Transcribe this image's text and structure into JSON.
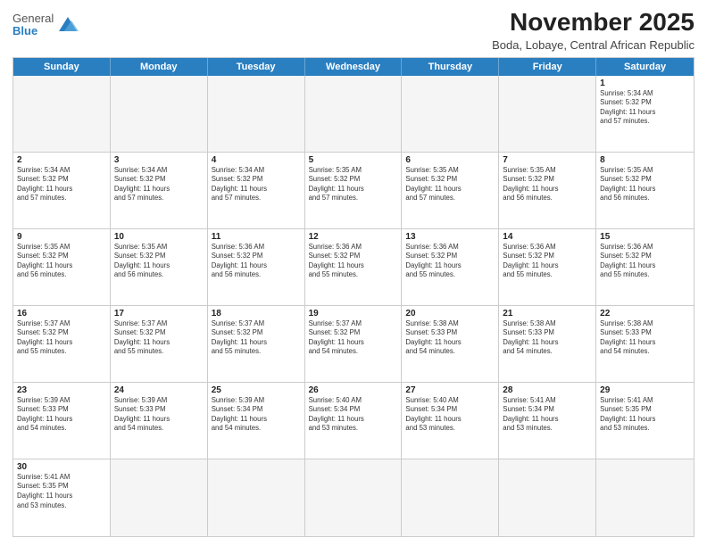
{
  "header": {
    "logo_general": "General",
    "logo_blue": "Blue",
    "title": "November 2025",
    "subtitle": "Boda, Lobaye, Central African Republic"
  },
  "days": [
    "Sunday",
    "Monday",
    "Tuesday",
    "Wednesday",
    "Thursday",
    "Friday",
    "Saturday"
  ],
  "weeks": [
    [
      {
        "num": "",
        "text": "",
        "empty": true
      },
      {
        "num": "",
        "text": "",
        "empty": true
      },
      {
        "num": "",
        "text": "",
        "empty": true
      },
      {
        "num": "",
        "text": "",
        "empty": true
      },
      {
        "num": "",
        "text": "",
        "empty": true
      },
      {
        "num": "",
        "text": "",
        "empty": true
      },
      {
        "num": "1",
        "text": "Sunrise: 5:34 AM\nSunset: 5:32 PM\nDaylight: 11 hours\nand 57 minutes.",
        "empty": false
      }
    ],
    [
      {
        "num": "2",
        "text": "Sunrise: 5:34 AM\nSunset: 5:32 PM\nDaylight: 11 hours\nand 57 minutes.",
        "empty": false
      },
      {
        "num": "3",
        "text": "Sunrise: 5:34 AM\nSunset: 5:32 PM\nDaylight: 11 hours\nand 57 minutes.",
        "empty": false
      },
      {
        "num": "4",
        "text": "Sunrise: 5:34 AM\nSunset: 5:32 PM\nDaylight: 11 hours\nand 57 minutes.",
        "empty": false
      },
      {
        "num": "5",
        "text": "Sunrise: 5:35 AM\nSunset: 5:32 PM\nDaylight: 11 hours\nand 57 minutes.",
        "empty": false
      },
      {
        "num": "6",
        "text": "Sunrise: 5:35 AM\nSunset: 5:32 PM\nDaylight: 11 hours\nand 57 minutes.",
        "empty": false
      },
      {
        "num": "7",
        "text": "Sunrise: 5:35 AM\nSunset: 5:32 PM\nDaylight: 11 hours\nand 56 minutes.",
        "empty": false
      },
      {
        "num": "8",
        "text": "Sunrise: 5:35 AM\nSunset: 5:32 PM\nDaylight: 11 hours\nand 56 minutes.",
        "empty": false
      }
    ],
    [
      {
        "num": "9",
        "text": "Sunrise: 5:35 AM\nSunset: 5:32 PM\nDaylight: 11 hours\nand 56 minutes.",
        "empty": false
      },
      {
        "num": "10",
        "text": "Sunrise: 5:35 AM\nSunset: 5:32 PM\nDaylight: 11 hours\nand 56 minutes.",
        "empty": false
      },
      {
        "num": "11",
        "text": "Sunrise: 5:36 AM\nSunset: 5:32 PM\nDaylight: 11 hours\nand 56 minutes.",
        "empty": false
      },
      {
        "num": "12",
        "text": "Sunrise: 5:36 AM\nSunset: 5:32 PM\nDaylight: 11 hours\nand 55 minutes.",
        "empty": false
      },
      {
        "num": "13",
        "text": "Sunrise: 5:36 AM\nSunset: 5:32 PM\nDaylight: 11 hours\nand 55 minutes.",
        "empty": false
      },
      {
        "num": "14",
        "text": "Sunrise: 5:36 AM\nSunset: 5:32 PM\nDaylight: 11 hours\nand 55 minutes.",
        "empty": false
      },
      {
        "num": "15",
        "text": "Sunrise: 5:36 AM\nSunset: 5:32 PM\nDaylight: 11 hours\nand 55 minutes.",
        "empty": false
      }
    ],
    [
      {
        "num": "16",
        "text": "Sunrise: 5:37 AM\nSunset: 5:32 PM\nDaylight: 11 hours\nand 55 minutes.",
        "empty": false
      },
      {
        "num": "17",
        "text": "Sunrise: 5:37 AM\nSunset: 5:32 PM\nDaylight: 11 hours\nand 55 minutes.",
        "empty": false
      },
      {
        "num": "18",
        "text": "Sunrise: 5:37 AM\nSunset: 5:32 PM\nDaylight: 11 hours\nand 55 minutes.",
        "empty": false
      },
      {
        "num": "19",
        "text": "Sunrise: 5:37 AM\nSunset: 5:32 PM\nDaylight: 11 hours\nand 54 minutes.",
        "empty": false
      },
      {
        "num": "20",
        "text": "Sunrise: 5:38 AM\nSunset: 5:33 PM\nDaylight: 11 hours\nand 54 minutes.",
        "empty": false
      },
      {
        "num": "21",
        "text": "Sunrise: 5:38 AM\nSunset: 5:33 PM\nDaylight: 11 hours\nand 54 minutes.",
        "empty": false
      },
      {
        "num": "22",
        "text": "Sunrise: 5:38 AM\nSunset: 5:33 PM\nDaylight: 11 hours\nand 54 minutes.",
        "empty": false
      }
    ],
    [
      {
        "num": "23",
        "text": "Sunrise: 5:39 AM\nSunset: 5:33 PM\nDaylight: 11 hours\nand 54 minutes.",
        "empty": false
      },
      {
        "num": "24",
        "text": "Sunrise: 5:39 AM\nSunset: 5:33 PM\nDaylight: 11 hours\nand 54 minutes.",
        "empty": false
      },
      {
        "num": "25",
        "text": "Sunrise: 5:39 AM\nSunset: 5:34 PM\nDaylight: 11 hours\nand 54 minutes.",
        "empty": false
      },
      {
        "num": "26",
        "text": "Sunrise: 5:40 AM\nSunset: 5:34 PM\nDaylight: 11 hours\nand 53 minutes.",
        "empty": false
      },
      {
        "num": "27",
        "text": "Sunrise: 5:40 AM\nSunset: 5:34 PM\nDaylight: 11 hours\nand 53 minutes.",
        "empty": false
      },
      {
        "num": "28",
        "text": "Sunrise: 5:41 AM\nSunset: 5:34 PM\nDaylight: 11 hours\nand 53 minutes.",
        "empty": false
      },
      {
        "num": "29",
        "text": "Sunrise: 5:41 AM\nSunset: 5:35 PM\nDaylight: 11 hours\nand 53 minutes.",
        "empty": false
      }
    ],
    [
      {
        "num": "30",
        "text": "Sunrise: 5:41 AM\nSunset: 5:35 PM\nDaylight: 11 hours\nand 53 minutes.",
        "empty": false
      },
      {
        "num": "",
        "text": "",
        "empty": true
      },
      {
        "num": "",
        "text": "",
        "empty": true
      },
      {
        "num": "",
        "text": "",
        "empty": true
      },
      {
        "num": "",
        "text": "",
        "empty": true
      },
      {
        "num": "",
        "text": "",
        "empty": true
      },
      {
        "num": "",
        "text": "",
        "empty": true
      }
    ]
  ]
}
